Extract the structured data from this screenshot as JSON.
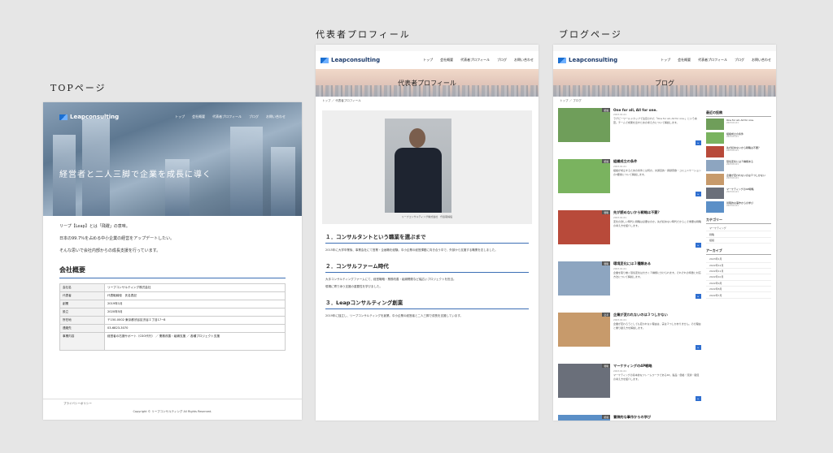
{
  "captions": {
    "top": "TOPページ",
    "profile": "代表者プロフィール",
    "blog": "ブログページ"
  },
  "brand": {
    "logo": "Leapconsulting",
    "accent": "#2f6fd0"
  },
  "nav": [
    "トップ",
    "会社概要",
    "代表者プロフィール",
    "ブログ",
    "お問い合わせ"
  ],
  "top_page": {
    "hero_text": "経営者と二人三脚で企業を成長に導く",
    "intro": [
      "リープ【Leap】とは「飛躍」の意味。",
      "日本の99.7％を占める中小企業の経営をアップデートしたい。",
      "そんな思いで会社内部からの成長支援を行っています。"
    ],
    "company_heading": "会社概要",
    "company_rows": [
      {
        "k": "会社名",
        "v": "リープコンサルティング株式会社"
      },
      {
        "k": "代表者",
        "v": "代表取締役　氏名表記"
      },
      {
        "k": "創業",
        "v": "2019年1月"
      },
      {
        "k": "設立",
        "v": "2020年5月"
      },
      {
        "k": "所在地",
        "v": "〒150-0002 東京都渋谷区渋谷１丁目17−8"
      },
      {
        "k": "連絡先",
        "v": "03-6823-3070"
      },
      {
        "k": "事業内容",
        "v": "経営者の右腕サポート（CSO代行） ／ 業務改善・組織支援 ／ 各種プロジェクト支援"
      }
    ],
    "privacy": "プライバシーポリシー",
    "copyright": "Copyright © リープコンサルティング All Rights Reserved."
  },
  "profile_page": {
    "title": "代表者プロフィール",
    "breadcrumb": "トップ ／ 代表者プロフィール",
    "photo_caption": "リープコンサルティング株式会社　代表取締役",
    "sections": [
      {
        "h": "１．コンサルタントという職業を選ぶまで",
        "p": [
          "2015年に大学卒業後、事業会社にて営業・企画職を経験。中小企業の経営課題に向き合う中で、外部から支援する職業を志しました。"
        ]
      },
      {
        "h": "２．コンサルファーム時代",
        "p": [
          "大手コンサルティングファームにて、経営戦略・業務改善・組織開発など幅広いプロジェクトを担当。",
          "現場に寄り添う支援の重要性を学びました。"
        ]
      },
      {
        "h": "３．Leapコンサルティング創業",
        "p": [
          "2019年に独立し、リープコンサルティングを創業。中小企業の経営者と二人三脚で成長を支援しています。"
        ]
      }
    ]
  },
  "blog_page": {
    "title": "ブログ",
    "breadcrumb": "トップ ／ ブログ",
    "posts": [
      {
        "t": "One for all, All for one.",
        "d": "2023.01.01",
        "cat": "組織",
        "x": "ラグビーワールドカップで注目された「One for all, All for one.」という言葉。チームで成果を出すための考え方について解説します。",
        "color": "#6f9e5a"
      },
      {
        "t": "組織成立の条件",
        "d": "2023.01.01",
        "cat": "組織",
        "x": "組織が成立するための条件とは何か。共通目的・貢献意欲・コミュニケーションの3要素について解説します。",
        "color": "#7ab35f"
      },
      {
        "t": "先が読めないから戦略は不要？",
        "d": "2023.01.01",
        "cat": "戦略",
        "x": "変化の激しい時代に戦略は必要なのか。先が読めない時代だからこそ重要な戦略の考え方を紹介します。",
        "color": "#b84a3a"
      },
      {
        "t": "環境変化には３種類ある",
        "d": "2023.01.01",
        "cat": "戦略",
        "x": "企業を取り巻く環境変化は大きく３種類に分けられます。それぞれの特徴と対応方法について解説します。",
        "color": "#8da5c0"
      },
      {
        "t": "企業が変われないのは３つしかない",
        "d": "2023.01.01",
        "cat": "変革",
        "x": "企業が変わろうとしても変われない理由は、実は３つしかありません。その理由と乗り越え方を解説します。",
        "color": "#c79a6b"
      },
      {
        "t": "マーケティングの4P戦略",
        "d": "2023.01.01",
        "cat": "戦略",
        "x": "マーケティングの基本的なフレームワークである4P。製品・価格・流通・販促の考え方を紹介します。",
        "color": "#6a6f7a"
      },
      {
        "t": "冒険的な事作からの学び",
        "d": "2023.01.01",
        "cat": "組織",
        "x": "冒険的な挑戦から得られる学びとは。組織で新しいことに取り組む際のヒントをまとめました。",
        "color": "#5b8fc7"
      }
    ],
    "sidebar": {
      "recent_heading": "最近の投稿",
      "recent": [
        {
          "t": "One for all, All for one.",
          "d": "2023.01.01"
        },
        {
          "t": "組織成立の条件",
          "d": "2023.01.01"
        },
        {
          "t": "先が読めないから戦略は不要？",
          "d": "2023.01.01"
        },
        {
          "t": "環境変化には３種類ある",
          "d": "2023.01.01"
        },
        {
          "t": "企業が変われないのは３つしかない",
          "d": "2023.01.01"
        },
        {
          "t": "マーケティングの4P戦略",
          "d": "2023.01.01"
        },
        {
          "t": "冒険的な事作からの学び",
          "d": "2023.01.01"
        }
      ],
      "category_heading": "カテゴリー",
      "categories": [
        "マーケティング",
        "戦略",
        "組織"
      ],
      "archive_heading": "アーカイブ",
      "archives": [
        "2023年1月",
        "2022年12月",
        "2022年11月",
        "2022年10月",
        "2022年9月",
        "2022年8月",
        "2022年7月"
      ]
    }
  }
}
